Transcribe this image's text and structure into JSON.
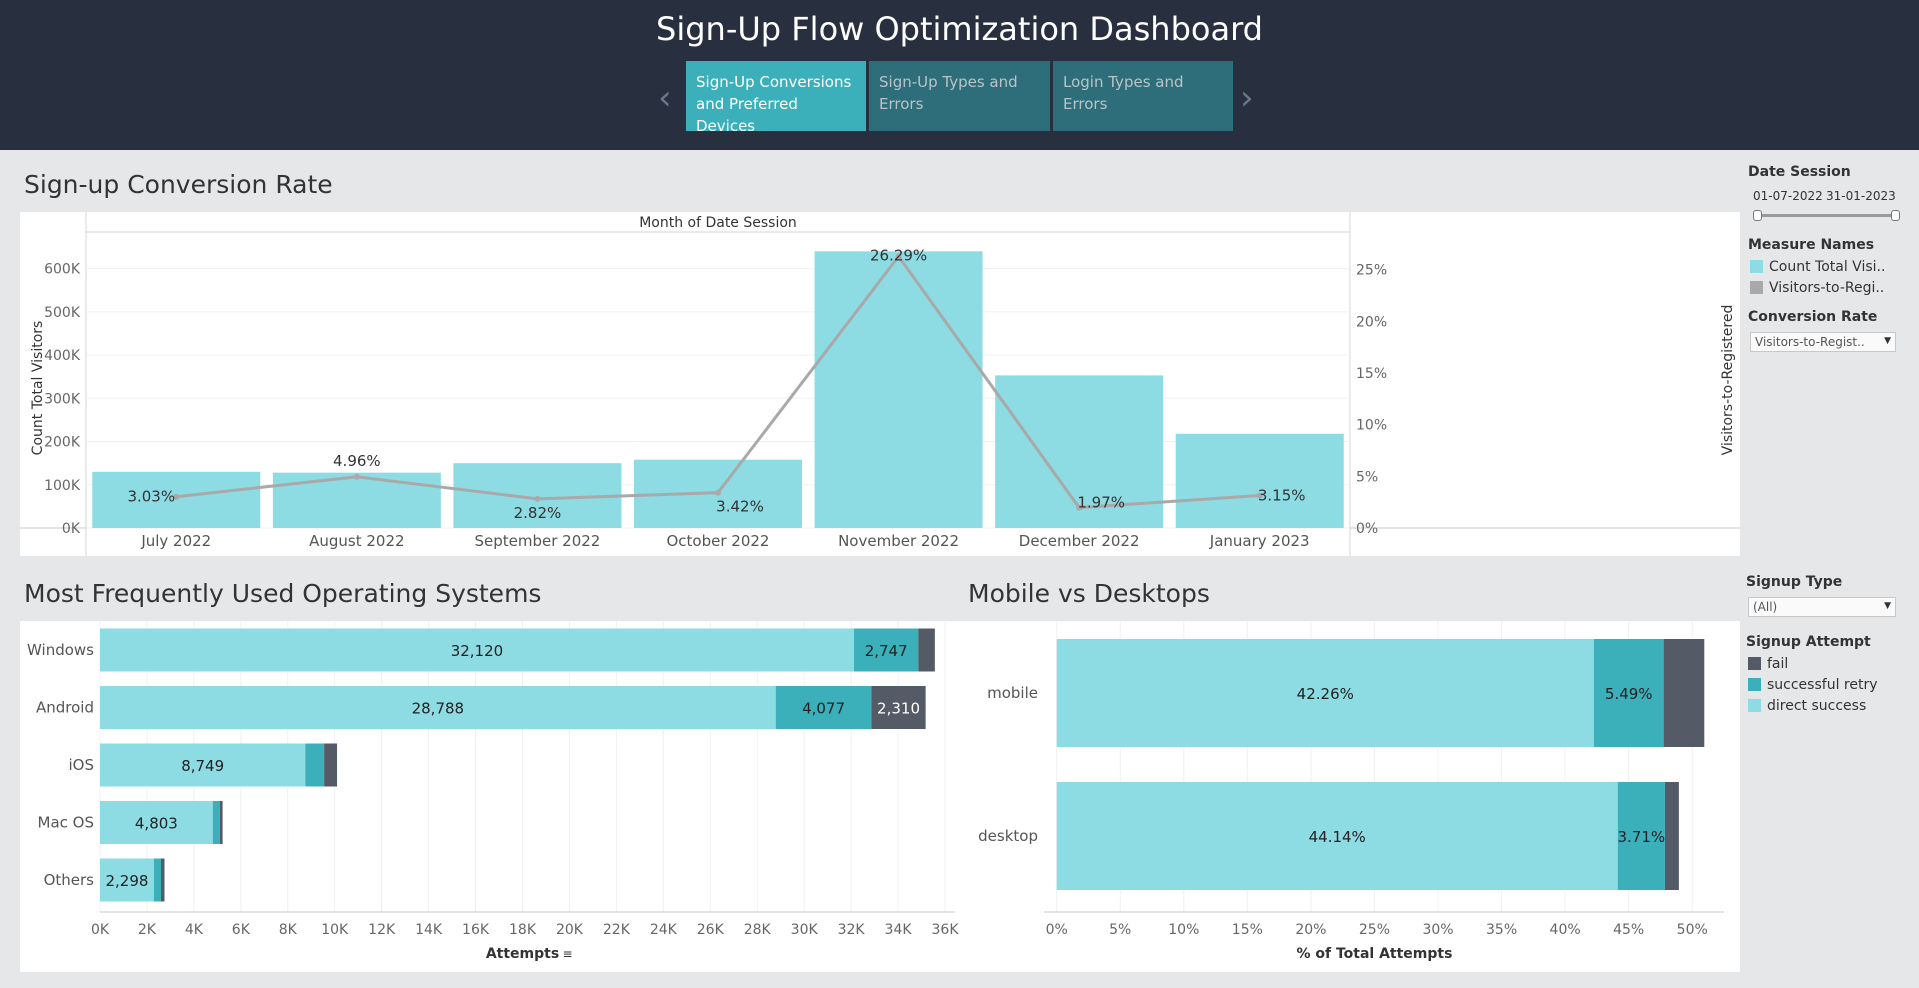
{
  "header": {
    "title": "Sign-Up Flow Optimization Dashboard",
    "tabs": [
      {
        "line1": "Sign-Up Conversions",
        "line2": "and Preferred Devices",
        "active": true
      },
      {
        "line1": "Sign-Up Types and",
        "line2": "Errors",
        "active": false
      },
      {
        "line1": "Login Types and Errors",
        "line2": "",
        "active": false
      }
    ],
    "prev_arrow": "‹",
    "next_arrow": "›"
  },
  "colors": {
    "header_bg": "#283040",
    "bar_light": "#8ddbe3",
    "bar_mid": "#3bb0ba",
    "bar_dark": "#555b66",
    "line_grey": "#a9a9a9",
    "tab_active": "#3bb0ba",
    "tab_inactive": "#2e6e7a"
  },
  "conversion_panel": {
    "title": "Sign-up Conversion Rate",
    "header_label": "Month of Date Session"
  },
  "os_panel": {
    "title": "Most Frequently Used Operating Systems"
  },
  "mobile_panel": {
    "title": "Mobile vs Desktops"
  },
  "filters": {
    "date_session_label": "Date Session",
    "date_start": "01-07-2022",
    "date_end": "31-01-2023",
    "measure_names_label": "Measure Names",
    "measure_names_items": [
      {
        "label": "Count Total Visi..",
        "color": "#8ddbe3"
      },
      {
        "label": "Visitors-to-Regi..",
        "color": "#a9a9a9"
      }
    ],
    "conversion_rate_label": "Conversion Rate",
    "conversion_rate_value": "Visitors-to-Regist..",
    "signup_type_label": "Signup Type",
    "signup_type_value": "(All)",
    "signup_attempt_label": "Signup Attempt",
    "signup_attempt_items": [
      {
        "label": "fail",
        "color": "#555b66"
      },
      {
        "label": "successful retry",
        "color": "#3bb0ba"
      },
      {
        "label": "direct success",
        "color": "#8ddbe3"
      }
    ]
  },
  "chart_data": [
    {
      "type": "bar",
      "title": "Sign-up Conversion Rate",
      "column_header": "Month of Date Session",
      "categories": [
        "July 2022",
        "August 2022",
        "September 2022",
        "October 2022",
        "November 2022",
        "December 2022",
        "January 2023"
      ],
      "series": [
        {
          "name": "Count Total Visitors",
          "values": [
            130000,
            128000,
            150000,
            158000,
            640000,
            353000,
            218000
          ],
          "axis": "left",
          "mark": "bar"
        },
        {
          "name": "Visitors-to-Registered",
          "values": [
            3.03,
            4.96,
            2.82,
            3.42,
            26.29,
            1.97,
            3.15
          ],
          "labels": [
            "3.03%",
            "4.96%",
            "2.82%",
            "3.42%",
            "26.29%",
            "1.97%",
            "3.15%"
          ],
          "axis": "right",
          "mark": "line"
        }
      ],
      "ylabel": "Count Total Visitors",
      "ylabel_right": "Visitors-to-Registered",
      "ylim": [
        0,
        650000
      ],
      "ylim_right": [
        0,
        27.2
      ],
      "yticks": [
        0,
        100000,
        200000,
        300000,
        400000,
        500000,
        600000
      ],
      "ytick_labels": [
        "0K",
        "100K",
        "200K",
        "300K",
        "400K",
        "500K",
        "600K"
      ],
      "yticks_right": [
        0,
        5,
        10,
        15,
        20,
        25
      ],
      "ytick_labels_right": [
        "0%",
        "5%",
        "10%",
        "15%",
        "20%",
        "25%"
      ],
      "grid": true
    },
    {
      "type": "bar",
      "orientation": "horizontal",
      "stacked": true,
      "title": "Most Frequently Used Operating Systems",
      "categories": [
        "Windows",
        "Android",
        "iOS",
        "Mac OS",
        "Others"
      ],
      "series": [
        {
          "name": "direct success",
          "values": [
            32120,
            28788,
            8749,
            4803,
            2298
          ],
          "labels": [
            "32,120",
            "28,788",
            "8,749",
            "4,803",
            "2,298"
          ]
        },
        {
          "name": "successful retry",
          "values": [
            2747,
            4077,
            800,
            300,
            300
          ],
          "labels": [
            "2,747",
            "4,077",
            "",
            "",
            ""
          ]
        },
        {
          "name": "fail",
          "values": [
            700,
            2310,
            550,
            120,
            150
          ],
          "labels": [
            "",
            "2,310",
            "",
            "",
            ""
          ]
        }
      ],
      "xlabel": "Attempts",
      "xlim": [
        0,
        36000
      ],
      "xticks": [
        0,
        2000,
        4000,
        6000,
        8000,
        10000,
        12000,
        14000,
        16000,
        18000,
        20000,
        22000,
        24000,
        26000,
        28000,
        30000,
        32000,
        34000,
        36000
      ],
      "xtick_labels": [
        "0K",
        "2K",
        "4K",
        "6K",
        "8K",
        "10K",
        "12K",
        "14K",
        "16K",
        "18K",
        "20K",
        "22K",
        "24K",
        "26K",
        "28K",
        "30K",
        "32K",
        "34K",
        "36K"
      ],
      "grid": true
    },
    {
      "type": "bar",
      "orientation": "horizontal",
      "stacked": true,
      "title": "Mobile vs Desktops",
      "categories": [
        "mobile",
        "desktop"
      ],
      "series": [
        {
          "name": "direct success",
          "values": [
            42.26,
            44.14
          ],
          "labels": [
            "42.26%",
            "44.14%"
          ]
        },
        {
          "name": "successful retry",
          "values": [
            5.49,
            3.71
          ],
          "labels": [
            "5.49%",
            "3.71%"
          ]
        },
        {
          "name": "fail",
          "values": [
            3.2,
            1.1
          ],
          "labels": [
            "",
            ""
          ]
        }
      ],
      "xlabel": "% of Total Attempts",
      "xlim": [
        -1,
        52.5
      ],
      "xticks": [
        0,
        5,
        10,
        15,
        20,
        25,
        30,
        35,
        40,
        45,
        50
      ],
      "xtick_labels": [
        "0%",
        "5%",
        "10%",
        "15%",
        "20%",
        "25%",
        "30%",
        "35%",
        "40%",
        "45%",
        "50%"
      ],
      "grid": true
    }
  ]
}
